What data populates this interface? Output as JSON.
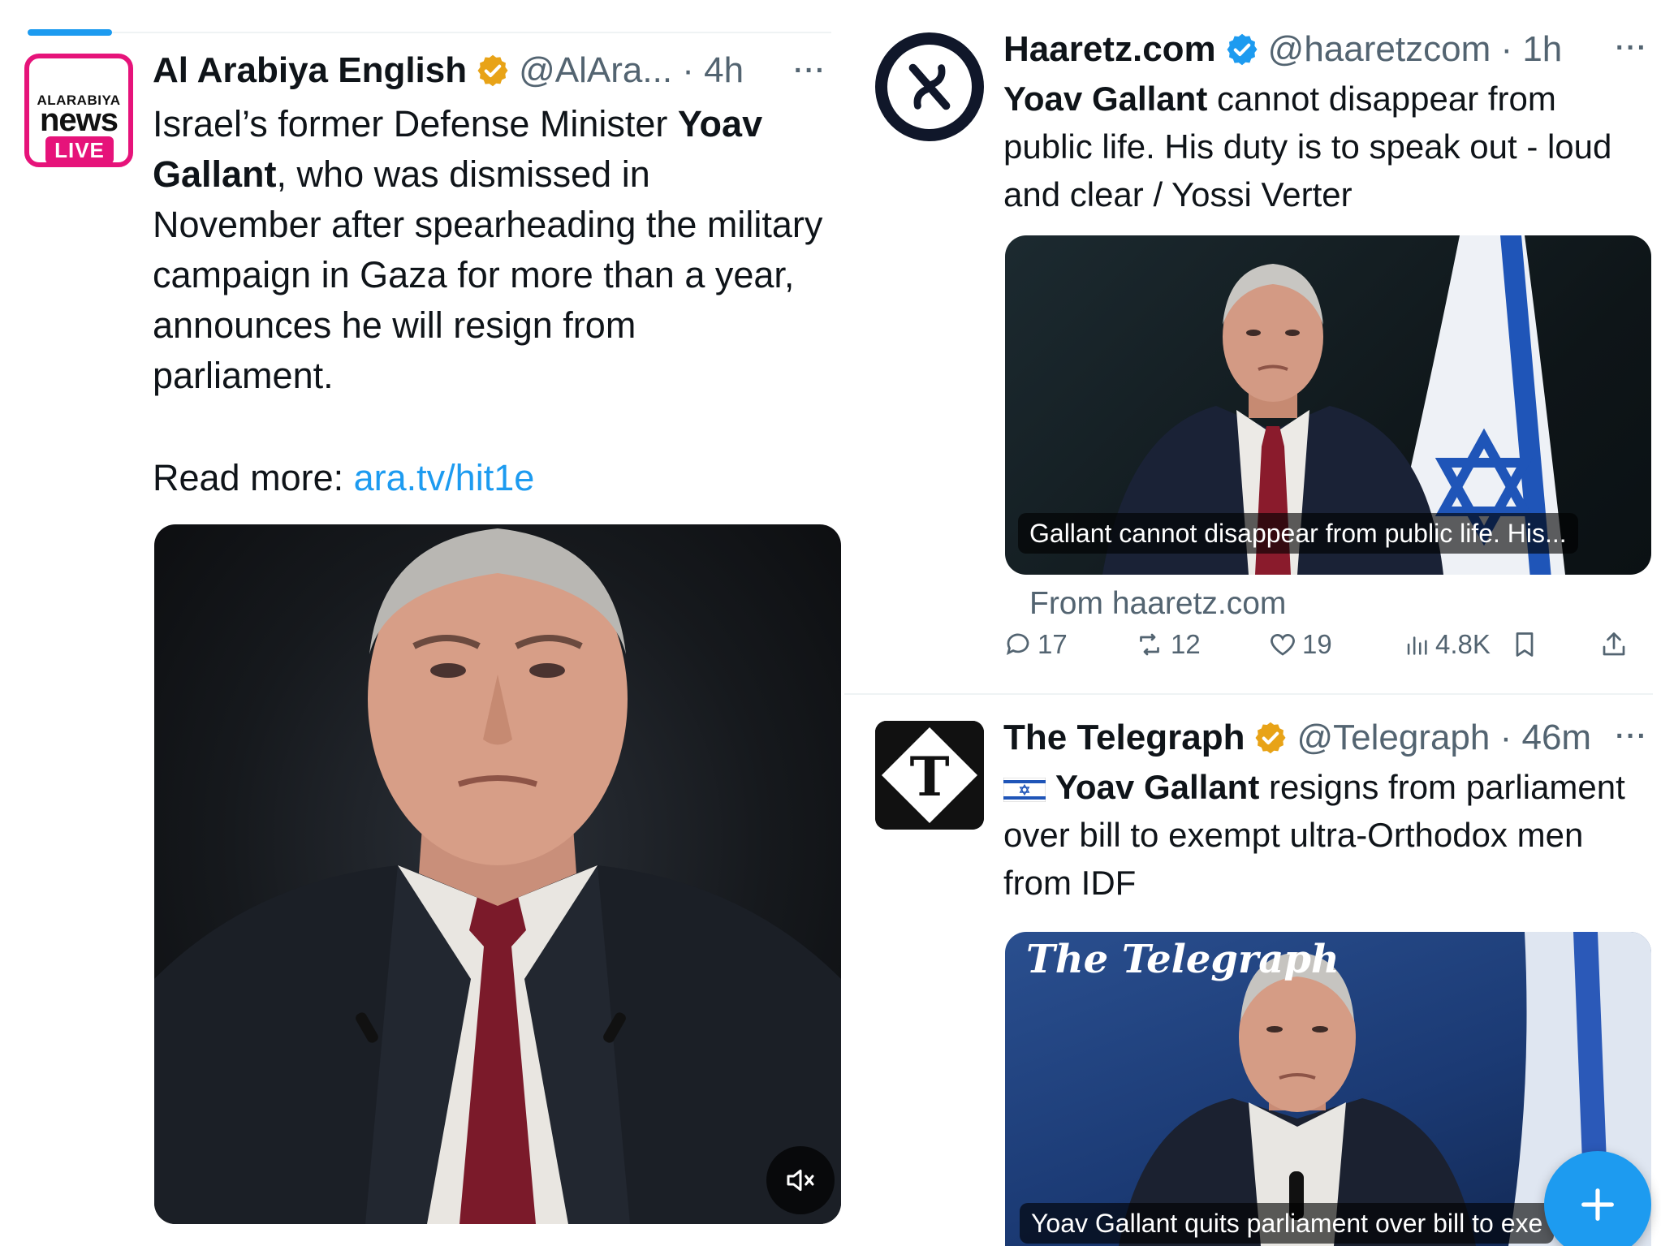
{
  "left_tweet": {
    "avatar": {
      "line1": "ALARABIYA",
      "line2": "news",
      "badge": "LIVE"
    },
    "display_name": "Al Arabiya English",
    "handle_time": "@AlAra... · 4h",
    "body_pre": "Israel’s former Defense Minister ",
    "body_bold": "Yoav Gallant",
    "body_post": ", who was dismissed in November after spearheading the military campaign in Gaza for more than a year, announces he will resign from parliament.",
    "read_more_label": "Read more: ",
    "read_more_link": "ara.tv/hit1e",
    "more_icon": "more-horizontal-icon",
    "video_mute_icon": "speaker-muted-icon"
  },
  "haaretz_tweet": {
    "avatar_letter": "ℵ",
    "display_name": "Haaretz.com",
    "handle_time": "@haaretzcom · 1h",
    "body_bold": "Yoav Gallant",
    "body_rest": " cannot disappear from public life. His duty is to speak out - loud and clear / Yossi Verter",
    "card_caption": "Gallant cannot disappear from public life. His...",
    "card_source": "From haaretz.com",
    "actions": {
      "replies": "17",
      "reposts": "12",
      "likes": "19",
      "views": "4.8K"
    }
  },
  "telegraph_tweet": {
    "avatar_letter": "T",
    "display_name": "The Telegraph",
    "handle_time": "@Telegraph · 46m",
    "flag_emoji": "🇮🇱",
    "body_bold": "Yoav Gallant",
    "body_rest": " resigns from parliament over bill to exempt ultra-Orthodox men from IDF",
    "card_masthead": "The Telegraph",
    "card_caption": "Yoav Gallant quits parliament over bill to exe"
  },
  "fab": {
    "icon": "plus-icon",
    "label": "+"
  },
  "colors": {
    "accent": "#1d9bf0",
    "verified_gold": "#e8a317",
    "verified_blue": "#1d9bf0",
    "alarabiya_pink": "#e6137a",
    "haaretz_navy": "#10172a"
  }
}
